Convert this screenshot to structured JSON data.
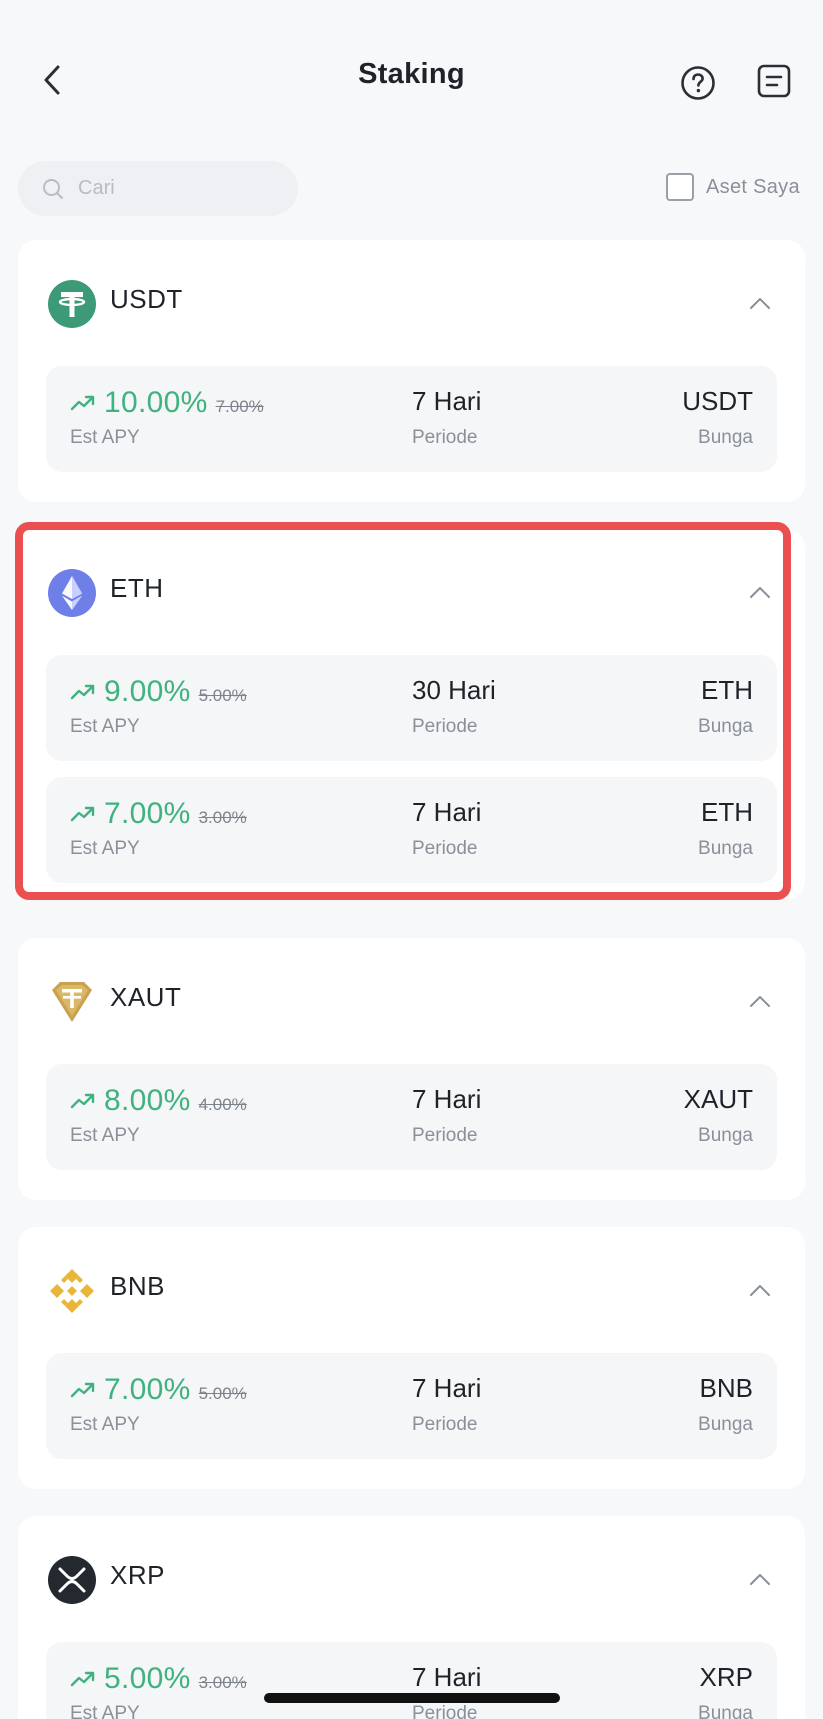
{
  "header": {
    "title": "Staking",
    "back_icon": "chevron-left-icon",
    "help_icon": "question-circle-icon",
    "records_icon": "document-list-icon"
  },
  "search": {
    "placeholder": "Cari"
  },
  "filter": {
    "my_assets_label": "Aset Saya",
    "checked": false
  },
  "colors": {
    "apy_green": "#3fb27f",
    "highlight_red": "#ec4f4f",
    "page_bg": "#f7f8fa"
  },
  "coins": [
    {
      "name": "USDT",
      "icon": "tether-icon",
      "products": [
        {
          "apy": "10.00%",
          "old_apy": "7.00%",
          "apy_label": "Est APY",
          "period": "7 Hari",
          "period_label": "Periode",
          "interest": "USDT",
          "interest_label": "Bunga"
        }
      ]
    },
    {
      "name": "ETH",
      "icon": "ethereum-icon",
      "products": [
        {
          "apy": "9.00%",
          "old_apy": "5.00%",
          "apy_label": "Est APY",
          "period": "30 Hari",
          "period_label": "Periode",
          "interest": "ETH",
          "interest_label": "Bunga"
        },
        {
          "apy": "7.00%",
          "old_apy": "3.00%",
          "apy_label": "Est APY",
          "period": "7 Hari",
          "period_label": "Periode",
          "interest": "ETH",
          "interest_label": "Bunga"
        }
      ]
    },
    {
      "name": "XAUT",
      "icon": "tether-gold-icon",
      "products": [
        {
          "apy": "8.00%",
          "old_apy": "4.00%",
          "apy_label": "Est APY",
          "period": "7 Hari",
          "period_label": "Periode",
          "interest": "XAUT",
          "interest_label": "Bunga"
        }
      ]
    },
    {
      "name": "BNB",
      "icon": "bnb-icon",
      "products": [
        {
          "apy": "7.00%",
          "old_apy": "5.00%",
          "apy_label": "Est APY",
          "period": "7 Hari",
          "period_label": "Periode",
          "interest": "BNB",
          "interest_label": "Bunga"
        }
      ]
    },
    {
      "name": "XRP",
      "icon": "xrp-icon",
      "products": [
        {
          "apy": "5.00%",
          "old_apy": "3.00%",
          "apy_label": "Est APY",
          "period": "7 Hari",
          "period_label": "Periode",
          "interest": "XRP",
          "interest_label": "Bunga"
        }
      ]
    }
  ]
}
